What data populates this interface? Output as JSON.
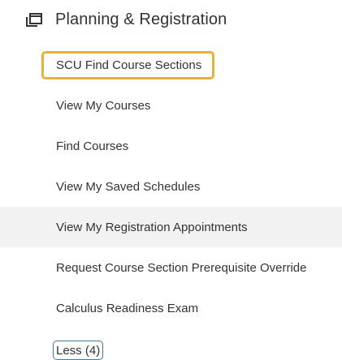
{
  "section": {
    "title": "Planning & Registration",
    "icon": "window-copy-icon"
  },
  "menu": {
    "items": [
      {
        "label": "SCU Find Course Sections"
      },
      {
        "label": "View My Courses"
      },
      {
        "label": "Find Courses"
      },
      {
        "label": "View My Saved Schedules"
      },
      {
        "label": "View My Registration Appointments"
      },
      {
        "label": "Request Course Section Prerequisite Override"
      },
      {
        "label": "Calculus Readiness Exam"
      }
    ]
  },
  "less_button": {
    "label": "Less (4)"
  },
  "colors": {
    "highlight_outline": "#e8b13a",
    "hover_row": "#f2f2f2",
    "button_border": "#3a7ea1",
    "text": "#333333"
  }
}
